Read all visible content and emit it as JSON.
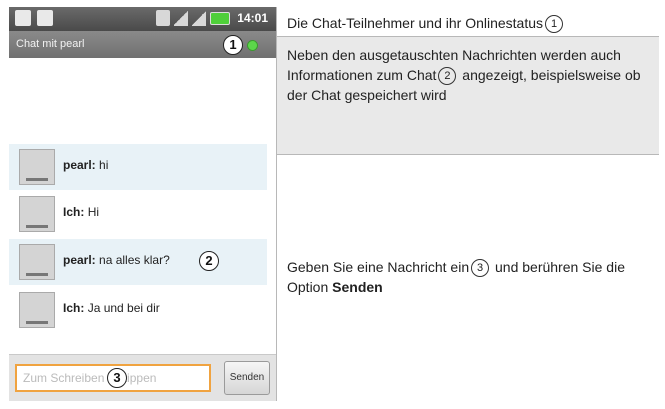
{
  "phone": {
    "status_time": "14:01",
    "title": "Chat mit pearl",
    "messages": [
      {
        "sender": "pearl:",
        "text": "hi"
      },
      {
        "sender": "Ich:",
        "text": "Hi"
      },
      {
        "sender": "pearl:",
        "text": "na alles klar?"
      },
      {
        "sender": "Ich:",
        "text": "Ja und bei dir"
      }
    ],
    "input_placeholder": "Zum Schreiben eintippen",
    "send_label": "Senden",
    "callouts": [
      "1",
      "2",
      "3"
    ]
  },
  "descriptions": {
    "row1": "Die Chat-Teilnehmer und ihr Onlinestatus",
    "row2_a": "Neben den ausgetauschten Nachrichten werden auch Informationen zum Chat",
    "row2_b": "angezeigt, beispielsweise ob der Chat gespeichert wird",
    "row3_a": "Geben Sie eine Nachricht ein",
    "row3_b": "und berühren Sie die Option",
    "row3_c": "Senden"
  },
  "colors": {
    "online": "#5cd64a",
    "input_focus": "#f0a340",
    "message_shade": "#e8f2f7",
    "desc_shade": "#e9e9e9"
  }
}
